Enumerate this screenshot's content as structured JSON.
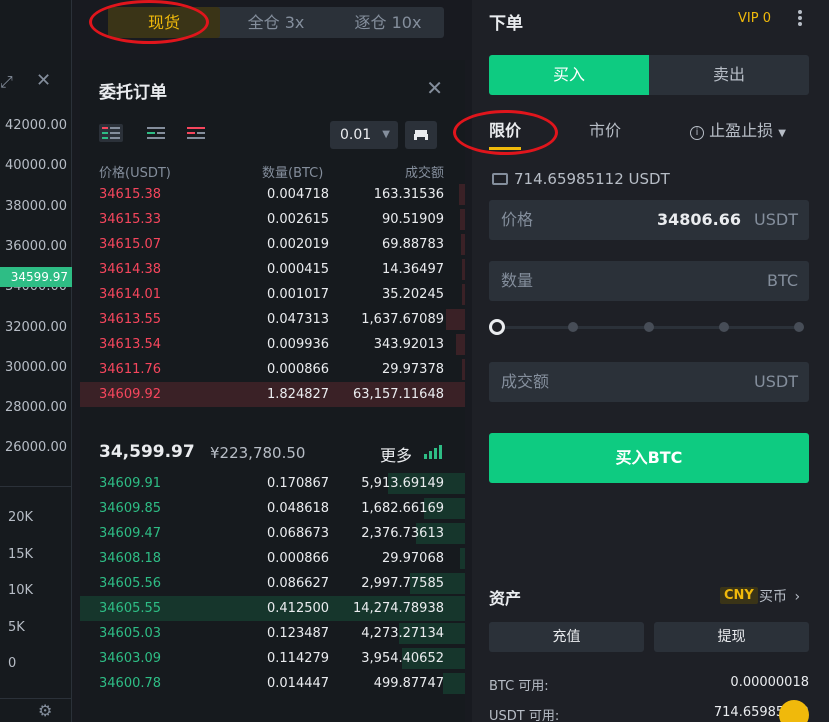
{
  "mode_tabs": [
    "现货",
    "全仓 3x",
    "逐仓 10x"
  ],
  "chart": {
    "price_ticks": [
      "42000.00",
      "40000.00",
      "38000.00",
      "36000.00",
      "34000.00",
      "32000.00",
      "30000.00",
      "28000.00",
      "26000.00"
    ],
    "current_price_tag": "34599.97",
    "volume_ticks": [
      "20K",
      "15K",
      "10K",
      "5K",
      "0"
    ]
  },
  "orderbook": {
    "title": "委托订单",
    "tick_size": "0.01",
    "headers": {
      "price": "价格(USDT)",
      "amount": "数量(BTC)",
      "total": "成交额"
    },
    "asks": [
      {
        "price": "34615.38",
        "amount": "0.004718",
        "total": "163.31536"
      },
      {
        "price": "34615.33",
        "amount": "0.002615",
        "total": "90.51909"
      },
      {
        "price": "34615.07",
        "amount": "0.002019",
        "total": "69.88783"
      },
      {
        "price": "34614.38",
        "amount": "0.000415",
        "total": "14.36497"
      },
      {
        "price": "34614.01",
        "amount": "0.001017",
        "total": "35.20245"
      },
      {
        "price": "34613.55",
        "amount": "0.047313",
        "total": "1,637.67089"
      },
      {
        "price": "34613.54",
        "amount": "0.009936",
        "total": "343.92013"
      },
      {
        "price": "34611.76",
        "amount": "0.000866",
        "total": "29.97378"
      },
      {
        "price": "34609.92",
        "amount": "1.824827",
        "total": "63,157.11648"
      }
    ],
    "last_price": "34,599.97",
    "last_price_cny": "¥223,780.50",
    "more_label": "更多",
    "bids": [
      {
        "price": "34609.91",
        "amount": "0.170867",
        "total": "5,913.69149"
      },
      {
        "price": "34609.85",
        "amount": "0.048618",
        "total": "1,682.66169"
      },
      {
        "price": "34609.47",
        "amount": "0.068673",
        "total": "2,376.73613"
      },
      {
        "price": "34608.18",
        "amount": "0.000866",
        "total": "29.97068"
      },
      {
        "price": "34605.56",
        "amount": "0.086627",
        "total": "2,997.77585"
      },
      {
        "price": "34605.55",
        "amount": "0.412500",
        "total": "14,274.78938"
      },
      {
        "price": "34605.03",
        "amount": "0.123487",
        "total": "4,273.27134"
      },
      {
        "price": "34603.09",
        "amount": "0.114279",
        "total": "3,954.40652"
      },
      {
        "price": "34600.78",
        "amount": "0.014447",
        "total": "499.87747"
      }
    ]
  },
  "form": {
    "title": "下单",
    "vip": "VIP 0",
    "buy_tab": "买入",
    "sell_tab": "卖出",
    "order_types": {
      "limit": "限价",
      "market": "市价",
      "stop": "止盈止损"
    },
    "available": "714.65985112 USDT",
    "price_label": "价格",
    "price_value": "34806.66",
    "price_unit": "USDT",
    "amount_label": "数量",
    "amount_unit": "BTC",
    "total_label": "成交额",
    "total_unit": "USDT",
    "submit": "买入BTC",
    "slider_percent": 0
  },
  "assets": {
    "title": "资产",
    "cny_badge": "CNY",
    "buy_coin": "买币",
    "deposit": "充值",
    "withdraw": "提现",
    "btc_label": "BTC 可用:",
    "btc_value": "0.00000018",
    "usdt_label": "USDT 可用:",
    "usdt_value": "714.65985112"
  },
  "colors": {
    "buy": "#0ecb81",
    "sell": "#f6465d",
    "accent": "#f0b90b",
    "highlight": "#e0151c"
  }
}
